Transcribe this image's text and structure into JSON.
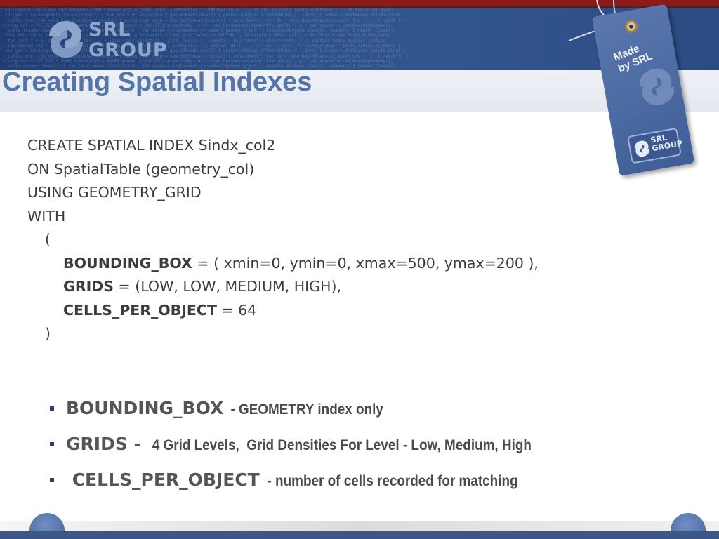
{
  "header": {
    "logo_text_line1": "SRL",
    "logo_text_line2": "GROUP"
  },
  "tag": {
    "text_line1": "Made",
    "text_line2": "by SRL",
    "badge_line1": "SRL",
    "badge_line2": "GROUP"
  },
  "title": "Creating Spatial Indexes",
  "code": {
    "line1": "CREATE SPATIAL INDEX Sindx_col2",
    "line2": "ON SpatialTable (geometry_col)",
    "line3": "USING GEOMETRY_GRID",
    "line4": "WITH",
    "open_paren": "(",
    "param1_key": "BOUNDING_BOX",
    "param1_value": " = ( xmin=0, ymin=0, xmax=500, ymax=200 ),",
    "param2_key": "GRIDS",
    "param2_value": " = (LOW, LOW, MEDIUM, HIGH),",
    "param3_key": "CELLS_PER_OBJECT",
    "param3_value": " = 64",
    "close_paren": ")"
  },
  "bullets": [
    {
      "term": "BOUNDING_BOX",
      "desc": "  - GEOMETRY index only"
    },
    {
      "term": "GRIDS -",
      "desc": "   4 Grid Levels,  Grid Densities For Level - Low, Medium, High"
    },
    {
      "term": " CELLS_PER_OBJECT",
      "desc": "  - number of cells recorded for matching"
    }
  ]
}
